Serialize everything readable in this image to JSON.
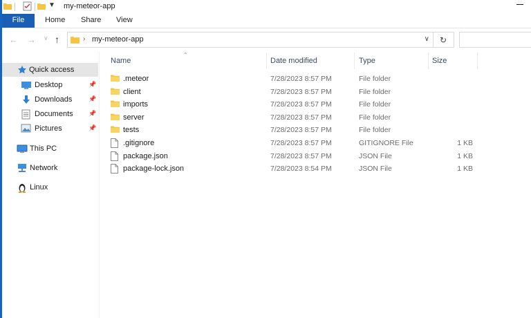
{
  "window": {
    "title": "my-meteor-app"
  },
  "ribbon": {
    "tabs": [
      "File",
      "Home",
      "Share",
      "View"
    ]
  },
  "address": {
    "path": "my-meteor-app"
  },
  "sidebar": {
    "items": [
      {
        "label": "Quick access",
        "icon": "star-icon",
        "pinned": false
      },
      {
        "label": "Desktop",
        "icon": "desktop-icon",
        "pinned": true
      },
      {
        "label": "Downloads",
        "icon": "download-icon",
        "pinned": true
      },
      {
        "label": "Documents",
        "icon": "documents-icon",
        "pinned": true
      },
      {
        "label": "Pictures",
        "icon": "pictures-icon",
        "pinned": true
      },
      {
        "label": "This PC",
        "icon": "computer-icon",
        "pinned": false
      },
      {
        "label": "Network",
        "icon": "network-icon",
        "pinned": false
      },
      {
        "label": "Linux",
        "icon": "linux-icon",
        "pinned": false
      }
    ]
  },
  "columns": {
    "name": "Name",
    "date": "Date modified",
    "type": "Type",
    "size": "Size"
  },
  "files": [
    {
      "name": ".meteor",
      "date": "7/28/2023 8:57 PM",
      "type": "File folder",
      "size": "",
      "kind": "folder"
    },
    {
      "name": "client",
      "date": "7/28/2023 8:57 PM",
      "type": "File folder",
      "size": "",
      "kind": "folder"
    },
    {
      "name": "imports",
      "date": "7/28/2023 8:57 PM",
      "type": "File folder",
      "size": "",
      "kind": "folder"
    },
    {
      "name": "server",
      "date": "7/28/2023 8:57 PM",
      "type": "File folder",
      "size": "",
      "kind": "folder"
    },
    {
      "name": "tests",
      "date": "7/28/2023 8:57 PM",
      "type": "File folder",
      "size": "",
      "kind": "folder"
    },
    {
      "name": ".gitignore",
      "date": "7/28/2023 8:57 PM",
      "type": "GITIGNORE File",
      "size": "1 KB",
      "kind": "file"
    },
    {
      "name": "package.json",
      "date": "7/28/2023 8:57 PM",
      "type": "JSON File",
      "size": "1 KB",
      "kind": "file"
    },
    {
      "name": "package-lock.json",
      "date": "7/28/2023 8:54 PM",
      "type": "JSON File",
      "size": "1 KB",
      "kind": "file"
    }
  ],
  "colors": {
    "accent": "#1a5fb4",
    "folder": "#f5c443",
    "selected": "#cce4f7"
  }
}
